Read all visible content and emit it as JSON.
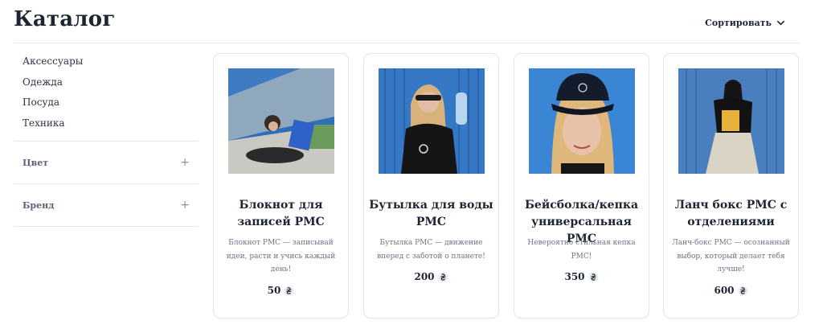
{
  "header": {
    "title": "Каталог",
    "sort_label": "Сортировать"
  },
  "sidebar": {
    "categories": [
      {
        "label": "Аксессуары"
      },
      {
        "label": "Одежда"
      },
      {
        "label": "Посуда"
      },
      {
        "label": "Техника"
      }
    ],
    "filters": [
      {
        "label": "Цвет",
        "icon": "plus-icon"
      },
      {
        "label": "Бренд",
        "icon": "plus-icon"
      }
    ]
  },
  "products": [
    {
      "title": "Блокнот для записей PMC",
      "description": "Блокнот PMC — записывай идеи, расти и учись каждый день!",
      "price": "50",
      "currency_icon": "hryvnia-icon"
    },
    {
      "title": "Бутылка для воды PMC",
      "description": "Бутылка PMC — движение вперед с заботой о планете!",
      "price": "200",
      "currency_icon": "hryvnia-icon"
    },
    {
      "title": "Бейсболка/кепка универсальная PMC",
      "description": "Невероятно стильная кепка PMC!",
      "price": "350",
      "currency_icon": "hryvnia-icon"
    },
    {
      "title": "Ланч бокс PMC с отделениями",
      "description": "Ланч-бокс PMC — осознанный выбор, который делает тебя лучше!",
      "price": "600",
      "currency_icon": "hryvnia-icon"
    }
  ],
  "colors": {
    "text": "#1d2432",
    "muted": "#6b7385",
    "border": "#e1e4e9",
    "photo_blue": "#2f6fb8"
  }
}
